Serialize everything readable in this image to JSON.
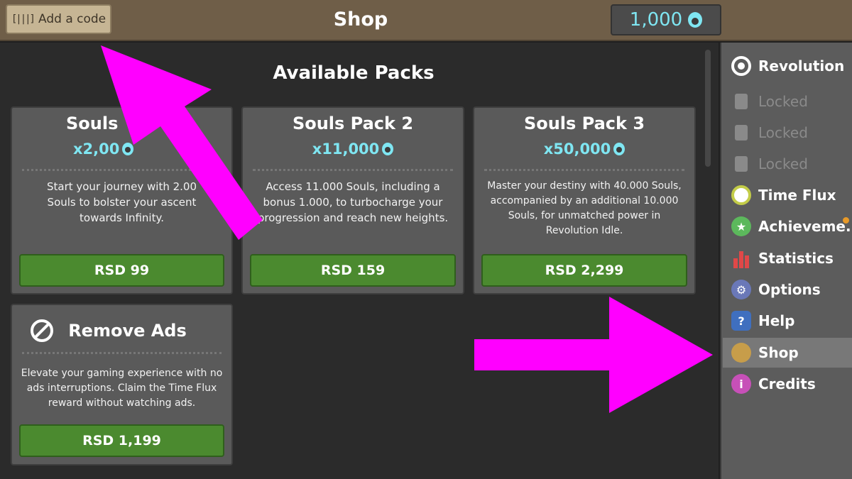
{
  "header": {
    "code_button_label": "Add a code",
    "barcode_glyph": "[|||]",
    "title": "Shop",
    "currency_amount": "1,000",
    "currency_icon": "soul-icon"
  },
  "main": {
    "heading": "Available Packs",
    "packs": [
      {
        "title": "Souls Pack 1",
        "title_visible": "Souls",
        "amount": "x2,000",
        "amount_visible": "x2,00",
        "description": "Start your journey with 2.000 Souls to bolster your ascent towards Infinity.",
        "description_visible": "Start your journey with 2.00\nSouls to bolster your ascent\ntowards Infinity.",
        "price": "RSD 99"
      },
      {
        "title": "Souls Pack 2",
        "amount": "x11,000",
        "description": "Access 11.000 Souls, including a bonus 1.000, to turbocharge your progression and reach new heights.",
        "price": "RSD 159"
      },
      {
        "title": "Souls Pack 3",
        "amount": "x50,000",
        "description": "Master your destiny with 40.000 Souls, accompanied by an additional 10.000 Souls, for unmatched power in Revolution Idle.",
        "price": "RSD 2,299"
      },
      {
        "title": "Remove Ads",
        "icon": "no-ads-icon",
        "description": "Elevate your gaming experience with no ads interruptions. Claim the Time Flux reward without watching ads.",
        "price": "RSD 1,199"
      }
    ]
  },
  "sidebar": {
    "items": [
      {
        "label": "Revolution",
        "icon": "revolution-icon",
        "state": "normal"
      },
      {
        "label": "Locked",
        "icon": "lock-icon",
        "state": "locked"
      },
      {
        "label": "Locked",
        "icon": "lock-icon",
        "state": "locked"
      },
      {
        "label": "Locked",
        "icon": "lock-icon",
        "state": "locked"
      },
      {
        "label": "Time Flux",
        "icon": "stopwatch-icon",
        "state": "normal"
      },
      {
        "label": "Achieveme...",
        "icon": "medal-icon",
        "state": "normal",
        "notification": true
      },
      {
        "label": "Statistics",
        "icon": "bar-chart-icon",
        "state": "normal"
      },
      {
        "label": "Options",
        "icon": "gear-icon",
        "state": "normal"
      },
      {
        "label": "Help",
        "icon": "question-icon",
        "state": "normal",
        "glyph": "?"
      },
      {
        "label": "Shop",
        "icon": "money-bag-icon",
        "state": "active"
      },
      {
        "label": "Credits",
        "icon": "info-icon",
        "state": "normal",
        "glyph": "i"
      }
    ]
  },
  "overlay": {
    "arrow_color": "#ff00ff"
  },
  "colors": {
    "header_bg": "#6f5e48",
    "accent_souls": "#7fe6f2",
    "buy_button": "#4b8a2f",
    "card_bg": "#5a5a5a"
  }
}
